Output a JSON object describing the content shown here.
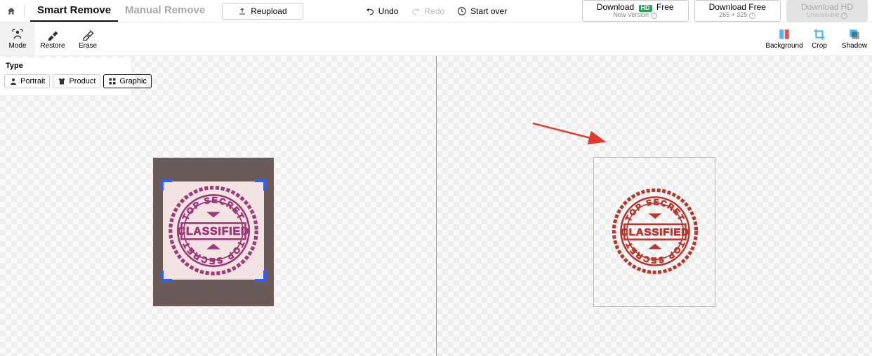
{
  "tabs": {
    "smart": "Smart Remove",
    "manual": "Manual Remove"
  },
  "reupload": "Reupload",
  "actions": {
    "undo": "Undo",
    "redo": "Redo",
    "startover": "Start over"
  },
  "download": {
    "hd_free": {
      "prefix": "Download",
      "badge": "HD",
      "suffix": "Free",
      "sub": "New Version"
    },
    "free": {
      "label": "Download Free",
      "sub": "265 × 325"
    },
    "hd": {
      "label": "Download HD",
      "sub": "Unavailable"
    }
  },
  "tools": {
    "mode": "Mode",
    "restore": "Restore",
    "erase": "Erase",
    "background": "Background",
    "crop": "Crop",
    "shadow": "Shadow"
  },
  "type": {
    "header": "Type",
    "portrait": "Portrait",
    "product": "Product",
    "graphic": "Graphic"
  },
  "stamp": {
    "top": "TOP SECRET",
    "mid": "CLASSIFIED",
    "bottom": "TOP SECRET"
  }
}
